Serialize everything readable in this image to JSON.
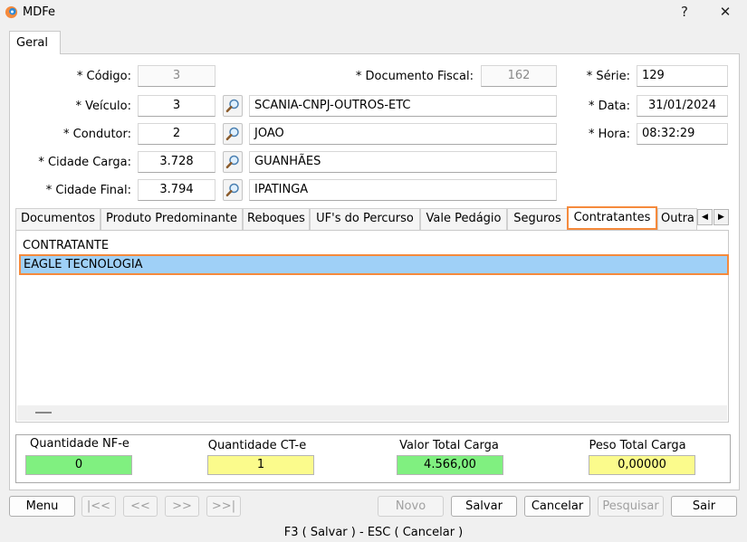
{
  "window": {
    "title": "MDFe",
    "help_label": "?",
    "close_label": "✕"
  },
  "main_tab": {
    "label": "Geral"
  },
  "form": {
    "codigo": {
      "label": "* Código:",
      "value": "3"
    },
    "documento_fiscal": {
      "label": "* Documento Fiscal:",
      "value": "162"
    },
    "serie": {
      "label": "* Série:",
      "value": "129"
    },
    "veiculo": {
      "label": "* Veículo:",
      "code": "3",
      "name": "SCANIA-CNPJ-OUTROS-ETC"
    },
    "data": {
      "label": "* Data:",
      "value": "31/01/2024"
    },
    "condutor": {
      "label": "* Condutor:",
      "code": "2",
      "name": "JOAO"
    },
    "hora": {
      "label": "* Hora:",
      "value": "08:32:29"
    },
    "cidade_carga": {
      "label": "* Cidade Carga:",
      "code": "3.728",
      "name": "GUANHÃES"
    },
    "cidade_final": {
      "label": "* Cidade Final:",
      "code": "3.794",
      "name": "IPATINGA"
    }
  },
  "subtabs": [
    "Documentos",
    "Produto Predominante",
    "Reboques",
    "UF's do Percurso",
    "Vale Pedágio",
    "Seguros",
    "Contratantes",
    "Outra"
  ],
  "active_subtab": "Contratantes",
  "list": {
    "header": "CONTRATANTE",
    "rows": [
      "EAGLE TECNOLOGIA"
    ]
  },
  "totals": {
    "qtd_nfe": {
      "label": "Quantidade NF-e",
      "value": "0",
      "color": "#80f080"
    },
    "qtd_cte": {
      "label": "Quantidade CT-e",
      "value": "1",
      "color": "#fbfb8c"
    },
    "valor_total": {
      "label": "Valor Total Carga",
      "value": "4.566,00",
      "color": "#80f080"
    },
    "peso_total": {
      "label": "Peso Total Carga",
      "value": "0,00000",
      "color": "#fbfb8c"
    }
  },
  "buttons": {
    "menu": "Menu",
    "first": "|<<",
    "prev": "<<",
    "next": ">>",
    "last": ">>|",
    "novo": "Novo",
    "salvar": "Salvar",
    "cancelar": "Cancelar",
    "pesquisar": "Pesquisar",
    "sair": "Sair"
  },
  "statusbar": {
    "text": "F3 ( Salvar )  -  ESC ( Cancelar )"
  },
  "colors": {
    "accent_orange": "#f58a3c",
    "selection_blue": "#9fd0f7"
  }
}
